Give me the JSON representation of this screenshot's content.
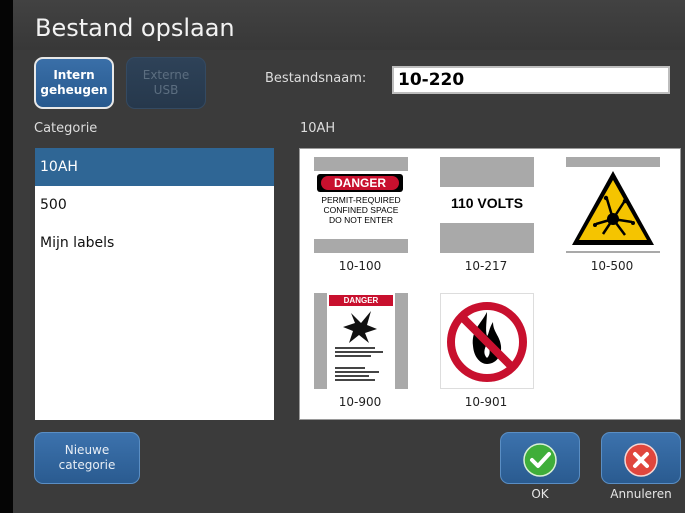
{
  "dialog": {
    "title": "Bestand opslaan"
  },
  "storage": {
    "internal_label": "Intern\ngeheugen",
    "external_label": "Externe\nUSB"
  },
  "filename": {
    "label": "Bestandsnaam:",
    "value": "10-220"
  },
  "categories": {
    "heading": "Categorie",
    "items": [
      {
        "label": "10AH",
        "selected": true
      },
      {
        "label": "500",
        "selected": false
      },
      {
        "label": "Mijn labels",
        "selected": false
      }
    ]
  },
  "files": {
    "heading": "10AH",
    "items": [
      {
        "name": "10-100",
        "thumb": "danger-sign"
      },
      {
        "name": "10-217",
        "thumb": "voltage-sign"
      },
      {
        "name": "10-500",
        "thumb": "explosive-warning-sign"
      },
      {
        "name": "10-900",
        "thumb": "danger-poster"
      },
      {
        "name": "10-901",
        "thumb": "no-open-flame-sign"
      }
    ],
    "thumb_text": {
      "danger_word": "DANGER",
      "danger_line1": "PERMIT-REQUIRED",
      "danger_line2": "CONFINED SPACE",
      "danger_line3": "DO NOT ENTER",
      "voltage": "110 VOLTS",
      "poster_header": "DANGER"
    }
  },
  "buttons": {
    "new_category": "Nieuwe\ncategorie",
    "ok": "OK",
    "cancel": "Annuleren"
  },
  "colors": {
    "selection": "#2f6695",
    "button_blue": "#3c72ad",
    "ok_green": "#3fae3a",
    "cancel_red": "#e0463d"
  }
}
